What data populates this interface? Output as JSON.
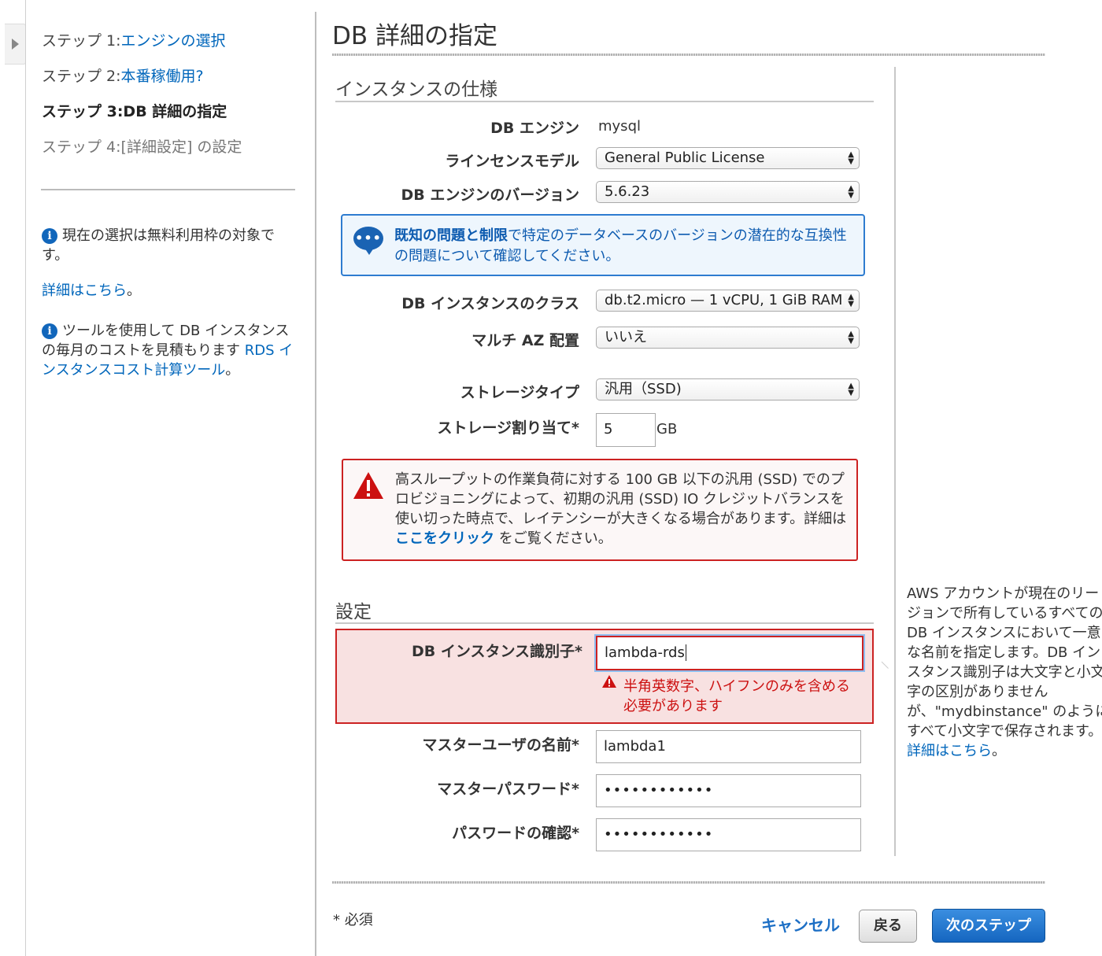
{
  "sidebar": {
    "steps": [
      {
        "prefix": "ステップ 1:",
        "link": "エンジンの選択"
      },
      {
        "prefix": "ステップ 2:",
        "link": "本番稼働用?"
      },
      {
        "label": "ステップ 3:DB 詳細の指定"
      },
      {
        "label": "ステップ 4:[詳細設定] の設定"
      }
    ],
    "free_tier_text": "現在の選択は無料利用枠の対象です。",
    "details_link": "詳細はこちら",
    "details_suffix": "。",
    "cost_text": "ツールを使用して DB インスタンスの毎月のコストを見積もります",
    "cost_link": "RDS インスタンスコスト計算ツール",
    "cost_suffix": "。",
    "info_icon_glyph": "i"
  },
  "page_title": "DB 詳細の指定",
  "instance_spec": {
    "title": "インスタンスの仕様",
    "db_engine_label": "DB エンジン",
    "db_engine_value": "mysql",
    "license_label": "ラインセンスモデル",
    "license_value": "General Public License",
    "version_label": "DB エンジンのバージョン",
    "version_value": "5.6.23",
    "info_banner": {
      "link": "既知の問題と制限",
      "text": "で特定のデータベースのバージョンの潜在的な互換性の問題について確認してください。",
      "icon": "chat-bubble-icon",
      "dots": "•••"
    },
    "class_label": "DB インスタンスのクラス",
    "class_value": "db.t2.micro — 1 vCPU, 1 GiB RAM",
    "multi_az_label": "マルチ AZ 配置",
    "multi_az_value": "いいえ",
    "storage_type_label": "ストレージタイプ",
    "storage_type_value": "汎用（SSD)",
    "storage_alloc_label": "ストレージ割り当て*",
    "storage_alloc_value": "5",
    "storage_unit": "GB",
    "warning": {
      "text_before": "高スループットの作業負荷に対する 100 GB 以下の汎用 (SSD) でのプロビジョニングによって、初期の汎用 (SSD) IO クレジットバランスを使い切った時点で、レイテンシーが大きくなる場合があります。詳細は ",
      "link": "ここをクリック",
      "text_after": " をご覧ください。"
    }
  },
  "settings": {
    "title": "設定",
    "identifier_label": "DB インスタンス識別子*",
    "identifier_value": "lambda-rds",
    "identifier_error": "半角英数字、ハイフンのみを含める必要があります",
    "master_user_label": "マスターユーザの名前*",
    "master_user_value": "lambda1",
    "master_password_label": "マスターパスワード*",
    "master_password_value": "••••••••••••",
    "confirm_password_label": "パスワードの確認*",
    "confirm_password_value": "••••••••••••"
  },
  "help": {
    "text": "AWS アカウントが現在のリージョンで所有しているすべての DB インスタンスにおいて一意な名前を指定します。DB インスタンス識別子は大文字と小文字の区別がありませんが、\"mydbinstance\" のようにすべて小文字で保存されます。 ",
    "link": "詳細はこちら",
    "suffix": "。"
  },
  "footer": {
    "required_note": "* 必須",
    "cancel": "キャンセル",
    "back": "戻る",
    "next": "次のステップ"
  },
  "colors": {
    "link": "#0066bb",
    "primary_button": "#1566c0",
    "error": "#cc2222",
    "info_border": "#2e7cd0"
  }
}
